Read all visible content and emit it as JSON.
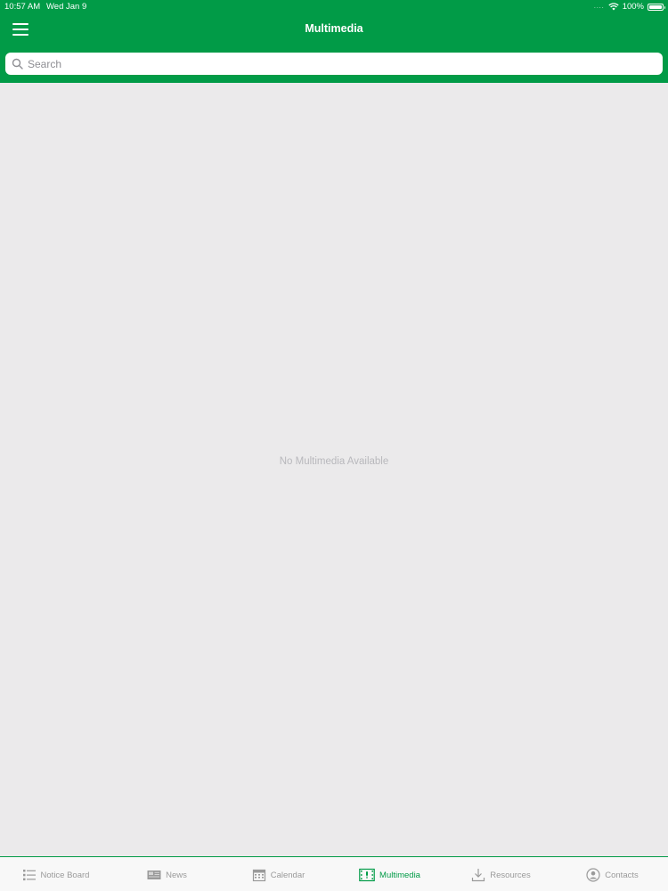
{
  "status_bar": {
    "time": "10:57 AM",
    "date": "Wed Jan 9",
    "signal": "....",
    "battery": "100%"
  },
  "header": {
    "title": "Multimedia"
  },
  "search": {
    "placeholder": "Search"
  },
  "content": {
    "empty_message": "No Multimedia Available"
  },
  "tabs": [
    {
      "label": "Notice Board",
      "icon": "list-icon",
      "active": false
    },
    {
      "label": "News",
      "icon": "newspaper-icon",
      "active": false
    },
    {
      "label": "Calendar",
      "icon": "calendar-icon",
      "active": false
    },
    {
      "label": "Multimedia",
      "icon": "film-icon",
      "active": true
    },
    {
      "label": "Resources",
      "icon": "download-icon",
      "active": false
    },
    {
      "label": "Contacts",
      "icon": "contact-icon",
      "active": false
    }
  ],
  "colors": {
    "brand": "#019b47",
    "background": "#ebeaeb",
    "tab_inactive": "#9a9a9a"
  }
}
